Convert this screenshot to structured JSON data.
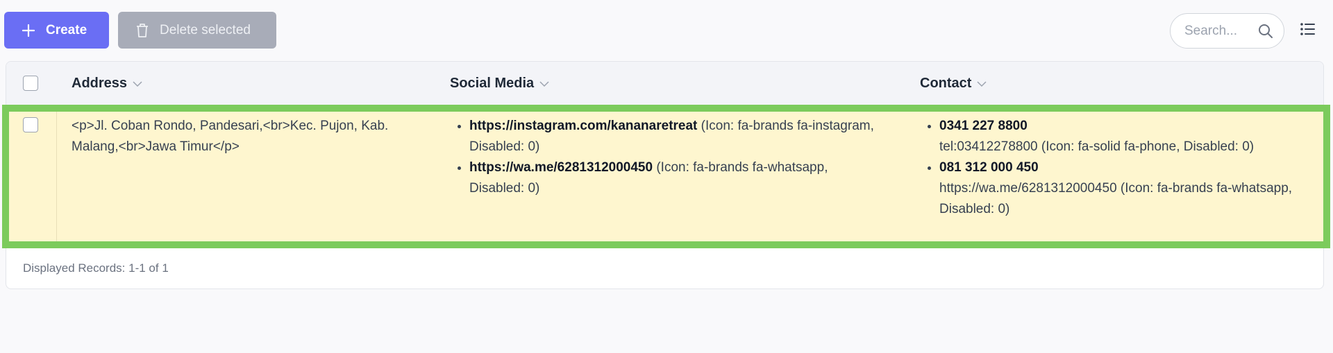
{
  "toolbar": {
    "create_label": "Create",
    "delete_label": "Delete selected",
    "search_placeholder": "Search..."
  },
  "table": {
    "columns": [
      "Address",
      "Social Media",
      "Contact"
    ],
    "rows": [
      {
        "address": "<p>Jl. Coban Rondo, Pandesari,<br>Kec. Pujon, Kab. Malang,<br>Jawa Timur</p>",
        "social": [
          {
            "bold": "https://instagram.com/kananaretreat",
            "rest": " (Icon: fa-brands fa-instagram, Disabled: 0)"
          },
          {
            "bold": "https://wa.me/6281312000450",
            "rest": " (Icon: fa-brands fa-whatsapp, Disabled: 0)"
          }
        ],
        "contact": [
          {
            "bold": "0341 227 8800",
            "rest": "tel:03412278800 (Icon: fa-solid fa-phone, Disabled: 0)"
          },
          {
            "bold": "081 312 000 450",
            "rest": "https://wa.me/6281312000450 (Icon: fa-brands fa-whatsapp, Disabled: 0)"
          }
        ]
      }
    ]
  },
  "footer": {
    "records": "Displayed Records: 1-1 of 1"
  },
  "colors": {
    "accent": "#6a6ef4",
    "highlight": "#7ccb5c",
    "row_bg": "#fef6cf"
  }
}
